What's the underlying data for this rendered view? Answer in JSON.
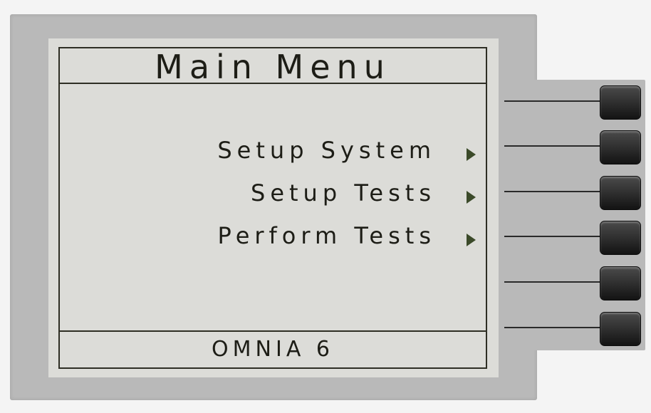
{
  "screen": {
    "title": "Main Menu",
    "footer": "OMNIA 6"
  },
  "menu": {
    "items": [
      {
        "label": "Setup System",
        "arrow_icon": "right-triangle-icon"
      },
      {
        "label": "Setup Tests",
        "arrow_icon": "right-triangle-icon"
      },
      {
        "label": "Perform Tests",
        "arrow_icon": "right-triangle-icon"
      }
    ]
  },
  "softkeys": {
    "count": 6
  },
  "colors": {
    "screen_bg": "#dcdcd8",
    "text": "#1d1d16",
    "arrow": "#3b4a29",
    "bezel": "#b9b9b9",
    "softkey": "#131313"
  }
}
